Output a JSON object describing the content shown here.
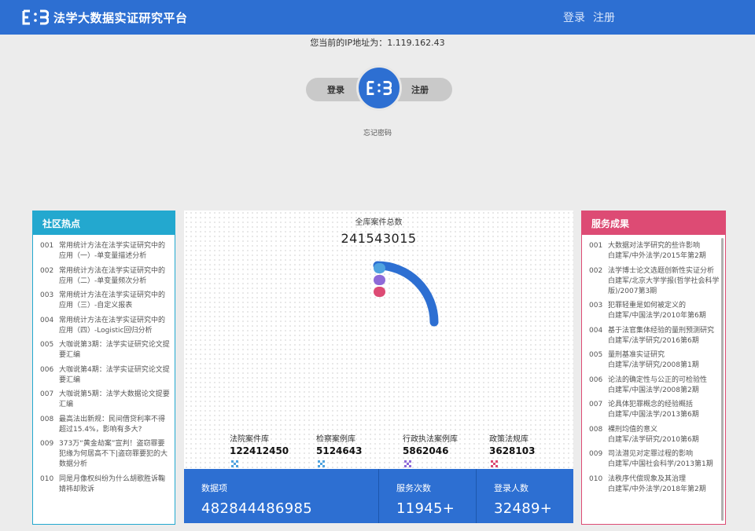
{
  "header": {
    "title": "法学大数据实证研究平台",
    "login": "登录",
    "register": "注册",
    "brand_color": "#2d6fd2"
  },
  "ip": {
    "text": "您当前的IP地址为：1.119.162.43"
  },
  "auth": {
    "login": "登录",
    "register": "注册",
    "forgot": "忘记密码"
  },
  "community": {
    "title": "社区热点",
    "color": "#23a8cf",
    "items": [
      {
        "num": "001",
        "text": "常用统计方法在法学实证研究中的应用（一）-单变量描述分析"
      },
      {
        "num": "002",
        "text": "常用统计方法在法学实证研究中的应用（二）-单变量频次分析"
      },
      {
        "num": "003",
        "text": "常用统计方法在法学实证研究中的应用（三）-自定义报表"
      },
      {
        "num": "004",
        "text": "常用统计方法在法学实证研究中的应用（四）-Logistic回归分析"
      },
      {
        "num": "005",
        "text": "大咖说第3期：法学实证研究论文提要汇编"
      },
      {
        "num": "006",
        "text": "大咖说第4期：法学实证研究论文提要汇编"
      },
      {
        "num": "007",
        "text": "大咖说第5期：法学大数据论文提要汇编"
      },
      {
        "num": "008",
        "text": "最高法出新规：民间借贷利率不得超过15.4%，影响有多大?"
      },
      {
        "num": "009",
        "text": "373万“黄金劫案”宣判！盗窃罪要犯缘为何居高不下|盗窃罪要犯的大数据分析"
      },
      {
        "num": "010",
        "text": "同是月像权纠纷为什么胡歌胜诉鞠婧祎却败诉"
      }
    ]
  },
  "results": {
    "title": "服务成果",
    "color": "#dd4b74",
    "items": [
      {
        "num": "001",
        "title": "大数据对法学研究的些许影响",
        "sub": "白建军/中外法学/2015年第2期"
      },
      {
        "num": "002",
        "title": "法学博士论文选题创新性实证分析",
        "sub": "白建军/北京大学学报(哲学社会科学版)/2007第3期"
      },
      {
        "num": "003",
        "title": "犯罪轻重是如何被定义的",
        "sub": "白建军/中国法学/2010年第6期"
      },
      {
        "num": "004",
        "title": "基于法官集体经验的量刑预测研究",
        "sub": "白建军/法学研究/2016第6期"
      },
      {
        "num": "005",
        "title": "量刑基准实证研究",
        "sub": "白建军/法学研究/2008第1期"
      },
      {
        "num": "006",
        "title": "论法的确定性与公正的可检验性",
        "sub": "白建军/中国法学/2008第2期"
      },
      {
        "num": "007",
        "title": "论具体犯罪概念的经验概括",
        "sub": "白建军/中国法学/2013第6期"
      },
      {
        "num": "008",
        "title": "裸刑均值的意义",
        "sub": "白建军/法学研究/2010第6期"
      },
      {
        "num": "009",
        "title": "司法潜见对定罪过程的影响",
        "sub": "白建军/中国社会科学/2013第1期"
      },
      {
        "num": "010",
        "title": "法秩序代偿现象及其治理",
        "sub": "白建军/中外法学/2018年第2期"
      }
    ]
  },
  "center": {
    "total_label": "全库案件总数",
    "total_value": "241543015",
    "gauge_fraction": 0.25,
    "dot_colors": [
      "#4fa3e0",
      "#8e6ad8",
      "#dd4b74"
    ],
    "libraries": [
      {
        "name": "法院案件库",
        "value": "122412450",
        "icon_color": "#4fa3e0"
      },
      {
        "name": "检察案例库",
        "value": "5124643",
        "icon_color": "#4fa3e0"
      },
      {
        "name": "行政执法案例库",
        "value": "5862046",
        "icon_color": "#8e6ad8"
      },
      {
        "name": "政策法规库",
        "value": "3628103",
        "icon_color": "#dd4b74"
      }
    ]
  },
  "stats": [
    {
      "label": "数据项",
      "value": "482844486985"
    },
    {
      "label": "服务次数",
      "value": "11945+"
    },
    {
      "label": "登录人数",
      "value": "32489+"
    }
  ]
}
